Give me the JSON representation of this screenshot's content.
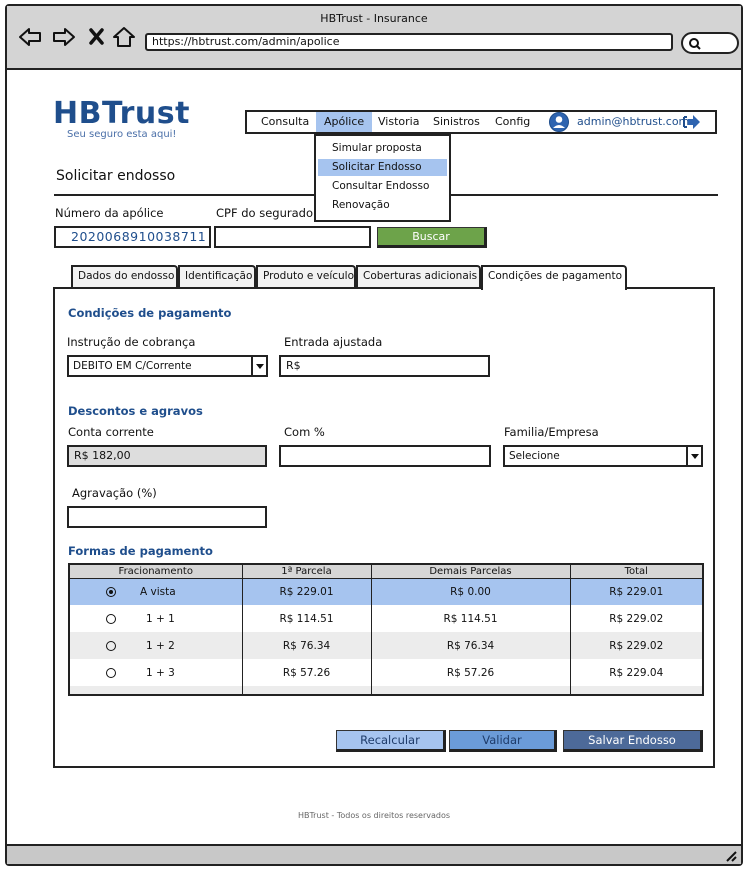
{
  "browser": {
    "title": "HBTrust - Insurance",
    "url": "https://hbtrust.com/admin/apolice",
    "icons": [
      "back-arrow-icon",
      "forward-arrow-icon",
      "close-icon",
      "home-icon",
      "search-icon"
    ]
  },
  "brand": {
    "logo": "HBTrust",
    "tagline": "Seu seguro esta aqui!"
  },
  "menu": {
    "items": [
      "Consulta",
      "Apólice",
      "Vistoria",
      "Sinistros",
      "Config"
    ],
    "active": "Apólice",
    "user_email": "admin@hbtrust.com"
  },
  "dropdown": {
    "items": [
      "Simular proposta",
      "Solicitar Endosso",
      "Consultar Endosso",
      "Renovação"
    ],
    "highlighted": "Solicitar Endosso"
  },
  "page": {
    "title": "Solicitar endosso",
    "policy_label": "Número da apólice",
    "policy_value": "2020068910038711",
    "cpf_label": "CPF do segurado",
    "cpf_value": "",
    "search_button": "Buscar"
  },
  "tabs": [
    "Dados do endosso",
    "Identificação",
    "Produto e veículo",
    "Coberturas adicionais",
    "Condições de pagamento"
  ],
  "active_tab": "Condições de pagamento",
  "payment": {
    "section_title": "Condições de pagamento",
    "billing_label": "Instrução de cobrança",
    "billing_value": "DEBITO EM C/Corrente",
    "entry_label": "Entrada ajustada",
    "entry_value": "R$"
  },
  "discounts": {
    "section_title": "Descontos e agravos",
    "account_label": "Conta corrente",
    "account_value": "R$ 182,00",
    "com_label": "Com %",
    "com_value": "",
    "family_label": "Familia/Empresa",
    "family_value": "Selecione",
    "aggravation_label": "Agravação (%)",
    "aggravation_value": ""
  },
  "forms": {
    "section_title": "Formas de pagamento",
    "headers": [
      "Fracionamento",
      "1ª Parcela",
      "Demais Parcelas",
      "Total"
    ],
    "rows": [
      {
        "label": "A vista",
        "first": "R$ 229.01",
        "others": "R$ 0.00",
        "total": "R$ 229.01",
        "selected": true
      },
      {
        "label": "1 + 1",
        "first": "R$ 114.51",
        "others": "R$ 114.51",
        "total": "R$ 229.02",
        "selected": false
      },
      {
        "label": "1 + 2",
        "first": "R$ 76.34",
        "others": "R$ 76.34",
        "total": "R$ 229.02",
        "selected": false
      },
      {
        "label": "1 + 3",
        "first": "R$ 57.26",
        "others": "R$ 57.26",
        "total": "R$ 229.04",
        "selected": false
      }
    ]
  },
  "actions": {
    "recalc": "Recalcular",
    "validate": "Validar",
    "save": "Salvar Endosso"
  },
  "footer": "HBTrust - Todos os direitos reservados",
  "colors": {
    "brand_blue": "#1f4e8c",
    "highlight": "#a6c4ef",
    "search_green": "#6da34a",
    "save_button": "#4d6a99"
  }
}
